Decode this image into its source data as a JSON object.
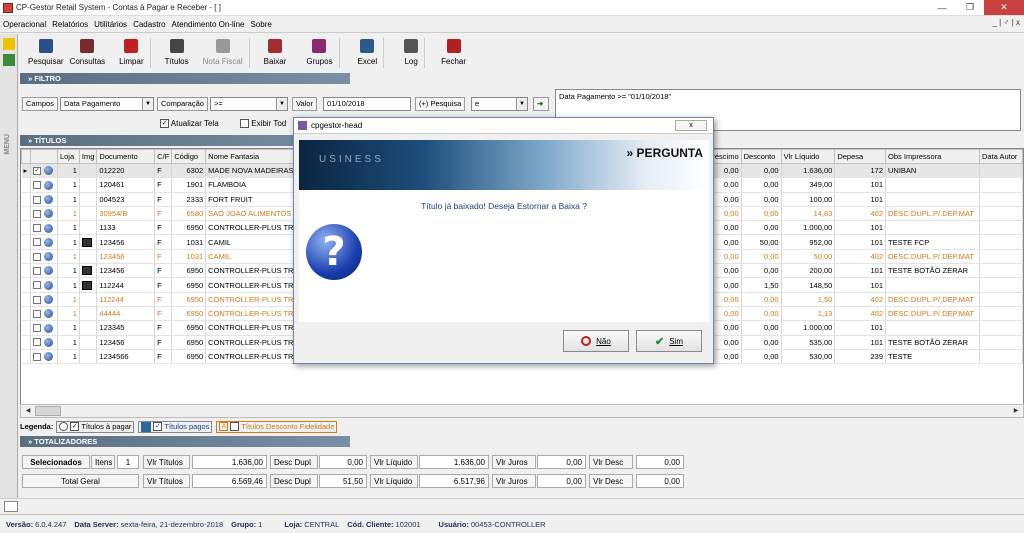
{
  "window": {
    "title": "CP-Gestor Retail System - Contas à Pagar e Receber - [ ]",
    "controls": [
      "0",
      "1",
      "r"
    ]
  },
  "menu": {
    "items": [
      "Operacional",
      "Relatórios",
      "Utilitários",
      "Cadastro",
      "Atendimento On-line",
      "Sobre"
    ],
    "mdi": "_ | ♂ | x"
  },
  "sidebar": {
    "label": "MENU"
  },
  "toolbar": {
    "buttons": [
      {
        "label": "Pesquisar",
        "icon": "search-icon",
        "color": "#2a4f8a"
      },
      {
        "label": "Consultas",
        "icon": "consult-icon",
        "color": "#7a2a2a"
      },
      {
        "label": "Limpar",
        "icon": "clear-x-icon",
        "color": "#c02020"
      },
      {
        "label": "Títulos",
        "icon": "titles-icon",
        "color": "#444"
      },
      {
        "label": "Nota Fiscal",
        "icon": "invoice-icon",
        "color": "#999"
      },
      {
        "label": "Baixar",
        "icon": "download-icon",
        "color": "#a03030"
      },
      {
        "label": "Grupos",
        "icon": "groups-icon",
        "color": "#8a2a6a"
      },
      {
        "label": "Excel",
        "icon": "excel-icon",
        "color": "#2a5a8a"
      },
      {
        "label": "Log",
        "icon": "log-icon",
        "color": "#555"
      },
      {
        "label": "Fechar",
        "icon": "close-door-icon",
        "color": "#b02020"
      }
    ]
  },
  "filtro": {
    "header": "» FILTRO",
    "campos_label": "Campos",
    "campos_value": "Data Pagamento",
    "comparacao_label": "Comparação",
    "comparacao_value": ">=",
    "valor_label": "Valor",
    "valor_value": "01/10/2018",
    "pesquisa_label": "(+) Pesquisa",
    "pesquisa_value": "e",
    "atualizar_label": "Atualizar Tela",
    "exibir_label": "Exibir Tod",
    "expression": "Data Pagamento >= \"01/10/2018\""
  },
  "titulos": {
    "header": "» TÍTULOS",
    "columns": [
      "",
      "",
      "Loja",
      "Img",
      "Documento",
      "C/F",
      "Código",
      "Nome Fantasia",
      "acréscimo",
      "Desconto",
      "Vlr Líquido",
      "Depesa",
      "Obs Impressora",
      "Data Autor"
    ],
    "rows": [
      {
        "loja": "1",
        "img": false,
        "doc": "012220",
        "cf": "F",
        "codigo": "6302",
        "nome": "MADE NOVA MADEIRAS",
        "acr": "0,00",
        "desc": "0,00",
        "liq": "1.636,00",
        "dep": "172",
        "obs": "UNIBAN",
        "style": "sel",
        "checked": true
      },
      {
        "loja": "1",
        "img": false,
        "doc": "120461",
        "cf": "F",
        "codigo": "1901",
        "nome": "FLAMBOIA",
        "acr": "0,00",
        "desc": "0,00",
        "liq": "349,00",
        "dep": "101",
        "obs": "",
        "style": ""
      },
      {
        "loja": "1",
        "img": false,
        "doc": "004523",
        "cf": "F",
        "codigo": "2333",
        "nome": "FORT FRUIT",
        "acr": "0,00",
        "desc": "0,00",
        "liq": "100,00",
        "dep": "101",
        "obs": "",
        "style": ""
      },
      {
        "loja": "1",
        "img": false,
        "doc": "30954/B",
        "cf": "F",
        "codigo": "6580",
        "nome": "SAO JOAO ALIMENTOS",
        "acr": "0,00",
        "desc": "0,00",
        "liq": "14,83",
        "dep": "402",
        "obs": "DESC.DUPL.P/.DEP.MAT",
        "style": "orange"
      },
      {
        "loja": "1",
        "img": false,
        "doc": "1133",
        "cf": "F",
        "codigo": "6950",
        "nome": "CONTROLLER-PLUS TRI",
        "acr": "0,00",
        "desc": "0,00",
        "liq": "1.000,00",
        "dep": "101",
        "obs": "",
        "style": ""
      },
      {
        "loja": "1",
        "img": true,
        "doc": "123456",
        "cf": "F",
        "codigo": "1031",
        "nome": "CAMIL",
        "acr": "0,00",
        "desc": "50,00",
        "liq": "952,00",
        "dep": "101",
        "obs": "TESTE FCP",
        "style": ""
      },
      {
        "loja": "1",
        "img": false,
        "doc": "123456",
        "cf": "F",
        "codigo": "1031",
        "nome": "CAMIL",
        "acr": "0,00",
        "desc": "0,00",
        "liq": "50,00",
        "dep": "402",
        "obs": "DESC.DUPL.P/.DEP.MAT",
        "style": "orange"
      },
      {
        "loja": "1",
        "img": true,
        "doc": "123456",
        "cf": "F",
        "codigo": "6950",
        "nome": "CONTROLLER-PLUS TRI",
        "acr": "0,00",
        "desc": "0,00",
        "liq": "200,00",
        "dep": "101",
        "obs": "TESTE BOTÃO ZERAR",
        "style": ""
      },
      {
        "loja": "1",
        "img": true,
        "doc": "112244",
        "cf": "F",
        "codigo": "6950",
        "nome": "CONTROLLER-PLUS TRI",
        "acr": "0,00",
        "desc": "1,50",
        "liq": "148,50",
        "dep": "101",
        "obs": "",
        "style": ""
      },
      {
        "loja": "1",
        "img": false,
        "doc": "112244",
        "cf": "F",
        "codigo": "6950",
        "nome": "CONTROLLER-PLUS TRI",
        "acr": "0,00",
        "desc": "0,00",
        "liq": "1,50",
        "dep": "402",
        "obs": "DESC.DUPL.P/.DEP.MAT",
        "style": "orange"
      },
      {
        "loja": "1",
        "img": false,
        "doc": "44444",
        "cf": "F",
        "codigo": "6950",
        "nome": "CONTROLLER-PLUS TRI",
        "acr": "0,00",
        "desc": "0,00",
        "liq": "1,13",
        "dep": "402",
        "obs": "DESC.DUPL.P/.DEP.MAT",
        "style": "orange"
      },
      {
        "loja": "1",
        "img": false,
        "doc": "123345",
        "cf": "F",
        "codigo": "6950",
        "nome": "CONTROLLER-PLUS TRI",
        "acr": "0,00",
        "desc": "0,00",
        "liq": "1.000,00",
        "dep": "101",
        "obs": "",
        "style": ""
      },
      {
        "loja": "1",
        "img": false,
        "doc": "123456",
        "cf": "F",
        "codigo": "6950",
        "nome": "CONTROLLER-PLUS TRI",
        "acr": "0,00",
        "desc": "0,00",
        "liq": "535,00",
        "dep": "101",
        "obs": "TESTE BOTÃO ZERAR",
        "style": ""
      },
      {
        "loja": "1",
        "img": false,
        "doc": "1234566",
        "cf": "F",
        "codigo": "6950",
        "nome": "CONTROLLER-PLUS TRI",
        "acr": "0,00",
        "desc": "0,00",
        "liq": "530,00",
        "dep": "239",
        "obs": "TESTE",
        "style": ""
      }
    ]
  },
  "legend": {
    "label": "Legenda:",
    "items": [
      {
        "text": "Títulos à pagar",
        "color": "#000"
      },
      {
        "text": "Títulos pagos",
        "color": "#1a3f9a"
      },
      {
        "text": "Títulos Desconto Fidelidade",
        "color": "#d47a18"
      }
    ]
  },
  "totalizadores": {
    "header": "» TOTALIZADORES",
    "sel": {
      "label": "Selecionados",
      "itens_label": "Itens",
      "itens": "1",
      "vt_label": "Vlr Títulos",
      "vt": "1.636,00",
      "dd_label": "Desc Dupl",
      "dd": "0,00",
      "vl_label": "Vlr Líquido",
      "vl": "1.636,00",
      "vj_label": "Vlr Juros",
      "vj": "0,00",
      "vd_label": "Vlr Desc",
      "vd": "0,00"
    },
    "tot": {
      "label": "Total Geral",
      "vt_label": "Vlr Títulos",
      "vt": "6.569,46",
      "dd_label": "Desc Dupl",
      "dd": "51,50",
      "vl_label": "Vlr Líquido",
      "vl": "6.517,96",
      "vj_label": "Vlr Juros",
      "vj": "0,00",
      "vd_label": "Vlr Desc",
      "vd": "0,00"
    }
  },
  "status": {
    "versao_label": "Versão:",
    "versao": "6.0.4.247",
    "ds_label": "Data Server:",
    "ds": "sexta-feira, 21-dezembro-2018",
    "grupo_label": "Grupo:",
    "grupo": "1",
    "loja_label": "Loja:",
    "loja": "CENTRAL",
    "cli_label": "Cód. Cliente:",
    "cli": "102001",
    "user_label": "Usuário:",
    "user": "00453-CONTROLLER"
  },
  "dialog": {
    "title": "cpgestor-head",
    "close": "x",
    "banner": "» PERGUNTA",
    "banner_word": "USINESS",
    "message": "Título já baixado! Deseja Estornar a Baixa ?",
    "no_label": "Não",
    "yes_label": "Sim"
  }
}
